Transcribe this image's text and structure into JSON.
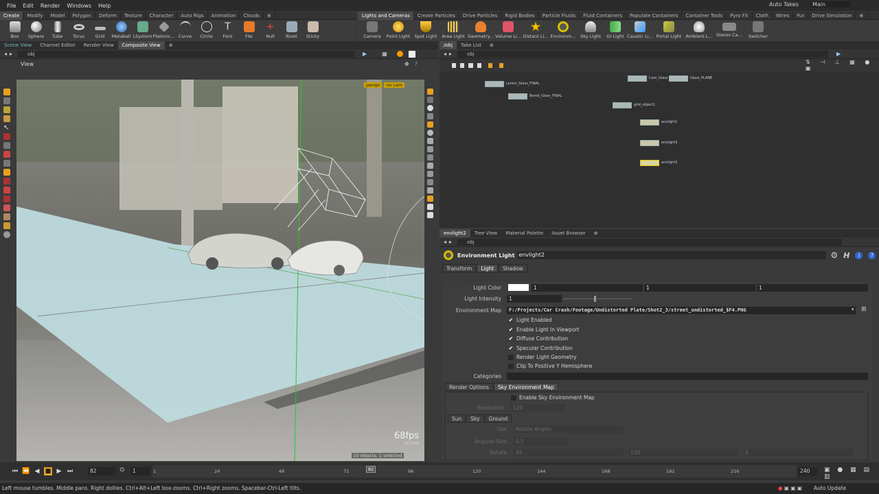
{
  "menu": {
    "items": [
      "File",
      "Edit",
      "Render",
      "Windows",
      "Help"
    ],
    "auto_takes": "Auto Takes",
    "desktop": "Main"
  },
  "left_shelf": {
    "tabs": [
      "Create",
      "Modify",
      "Model",
      "Polygon",
      "Deform",
      "Texture",
      "Character",
      "Auto Rigs",
      "Animation",
      "Clouds"
    ],
    "tools": [
      "Box",
      "Sphere",
      "Tube",
      "Torus",
      "Grid",
      "Metaball",
      "LSystem",
      "Platonic...",
      "Curve",
      "Circle",
      "Font",
      "File",
      "Null",
      "Rivet",
      "Sticky"
    ]
  },
  "right_shelf": {
    "tabs": [
      "Lights and Cameras",
      "Create Particles",
      "Drive Particles",
      "Rigid Bodies",
      "Particle Fluids",
      "Fluid Containers",
      "Populate Containers",
      "Container Tools",
      "Pyro FX",
      "Cloth",
      "Wires",
      "Fur",
      "Drive Simulation"
    ],
    "tools": [
      "Camera",
      "Point Light",
      "Spot Light",
      "Area Light",
      "Geometry...",
      "Volume Li...",
      "Distant Li...",
      "Environm...",
      "Sky Light",
      "GI Light",
      "Caustic Li...",
      "Portal Light",
      "Ambient L...",
      "Stereo Ca...",
      "Switcher"
    ]
  },
  "viewer": {
    "tabs": [
      "Scene View",
      "Channel Editor",
      "Render View",
      "Composite View"
    ],
    "path": "obj",
    "title": "View",
    "camera_menu": "perspi",
    "cam_label": "no cam",
    "fps": "68fps",
    "ms": "14.7ms",
    "selection": "10 objects, 1 selected"
  },
  "network": {
    "tabs": [
      "/obj",
      "Take List"
    ],
    "path": "obj",
    "nodes": [
      "Lorem_Glass_FINAL",
      "Bomb_Glass_FINAL",
      "grid_object1",
      "envlight1",
      "envlight3",
      "envlight2",
      "Cam_Glass",
      "Glass_PLANE"
    ]
  },
  "params": {
    "tabs": [
      "envlight2",
      "Tree View",
      "Material Palette",
      "Asset Browser"
    ],
    "path": "obj",
    "node_type": "Environment Light",
    "node_name": "envlight2",
    "section_tabs": [
      "Transform",
      "Light",
      "Shadow"
    ],
    "light_color_label": "Light Color",
    "light_color": [
      "1",
      "1",
      "1"
    ],
    "light_intensity_label": "Light Intensity",
    "light_intensity": "1",
    "env_map_label": "Environment Map",
    "env_map": "F:/Projects/Car Crash/Footage/Undistorted Plate/Shot2_3/street_undistorted_$F4.PNG",
    "checks": [
      {
        "label": "Light Enabled",
        "on": true
      },
      {
        "label": "Enable Light In Viewport",
        "on": true
      },
      {
        "label": "Diffuse Contribution",
        "on": true
      },
      {
        "label": "Specular Contribution",
        "on": true
      },
      {
        "label": "Render Light Geometry",
        "on": false
      },
      {
        "label": "Clip To Positive Y Hemisphere",
        "on": false
      }
    ],
    "categories_label": "Categories",
    "sub_tabs": [
      "Render Options",
      "Sky Environment Map"
    ],
    "enable_sky": "Enable Sky Environment Map",
    "resolution_label": "Resolution",
    "resolution_value": "128",
    "sky_tabs": [
      "Sun",
      "Sky",
      "Ground"
    ],
    "use_label": "Use",
    "use_value": "Rotate Angles",
    "angular_label": "Angular Size",
    "angular_value": "0.5",
    "rotate_label": "Rotate",
    "rotate_values": [
      "45",
      "150",
      "0"
    ]
  },
  "timeline": {
    "frame": "82",
    "start": "1",
    "ticks": [
      "1",
      "24",
      "48",
      "72",
      "82",
      "96",
      "120",
      "144",
      "168",
      "192",
      "216"
    ],
    "end": "240",
    "auto_update": "Auto Update"
  },
  "status": "Left mouse tumbles. Middle pans. Right dollies. Ctrl+Alt+Left box-zooms. Ctrl+Right zooms. Spacebar-Ctrl-Left tilts.",
  "colors": {
    "accent": "#f0a020",
    "selected_tab": "#4a4a4a",
    "node_fill": "#aab8b8"
  }
}
